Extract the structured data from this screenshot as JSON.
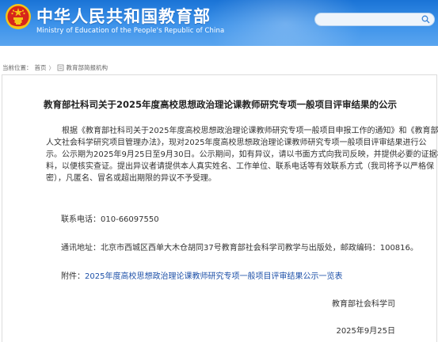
{
  "header": {
    "title_cn": "中华人民共和国教育部",
    "title_en": "Ministry of Education of the People's Republic of China",
    "search_placeholder": ""
  },
  "breadcrumb": {
    "prefix": "当前位置：",
    "home": "首页",
    "separator": "〉",
    "section": "教育部简报机构"
  },
  "article": {
    "title": "教育部社科司关于2025年度高校思想政治理论课教师研究专项一般项目评审结果的公示",
    "body_lines": [
      "根据《教育部社科司关于2025年度高校思想政治理论课教师研究专项一般项目申报工作的通知》和《教育部",
      "人文社会科学研究项目管理办法》，现对2025年度高校思想政治理论课教师研究专项一般项目评审结果进行公",
      "示。公示期为2025年9月25日至9月30日。公示期间，如有异议，请以书面方式向我司反映，并提供必要的证据材",
      "料，以便核实查证。提出异议者请提供本人真实姓名、工作单位、联系电话等有效联系方式（我司将予以严格保",
      "密），凡匿名、冒名或超出期限的异议不予受理。"
    ],
    "phone": "联系电话：010-66097550",
    "address": "通讯地址：北京市西城区西单大木仓胡同37号教育部社会科学司教学与出版处，邮政编码：100816。",
    "attachment_label": "附件：",
    "attachment_link": "2025年度高校思想政治理论课教师研究专项一般项目评审结果公示一览表",
    "signature": "教育部社会科学司",
    "date": "2025年9月25日"
  },
  "colors": {
    "header_blue": "#1a73d6",
    "link_blue": "#1d50a8",
    "emblem_red": "#d7261b",
    "emblem_gold": "#f5c518"
  }
}
